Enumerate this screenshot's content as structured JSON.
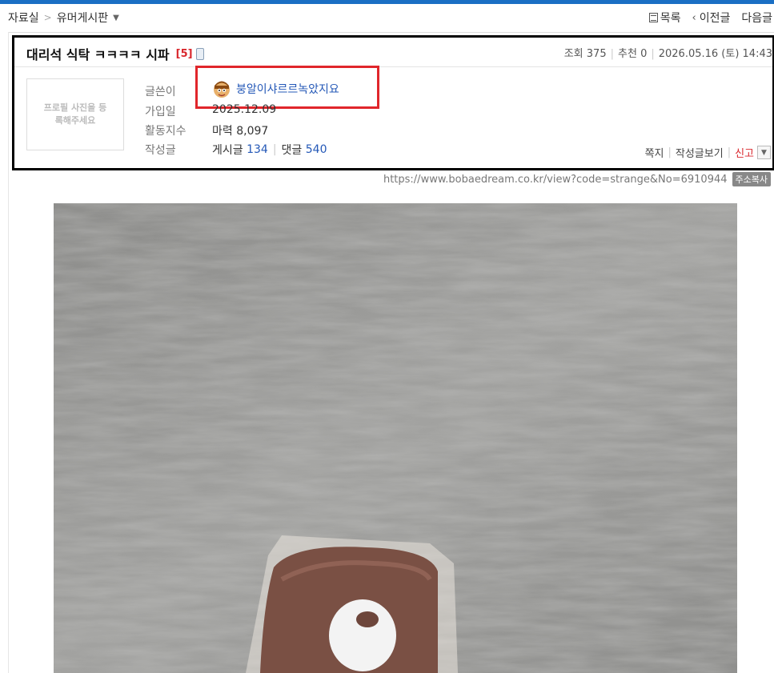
{
  "breadcrumb": {
    "section": "자료실",
    "separator": ">",
    "board": "유머게시판"
  },
  "topnav": {
    "list": "목록",
    "prev": "이전글",
    "next": "다음글"
  },
  "post": {
    "title": "대리석 식탁 ㅋㅋㅋㅋ 시파",
    "comment_count": "[5]",
    "views_label": "조회",
    "views": "375",
    "recommend_label": "추천",
    "recommend": "0",
    "date": "2026.05.16 (토) 14:43"
  },
  "profile": {
    "photo_placeholder": "프로필 사진을 등록해주세요",
    "author_label": "글쓴이",
    "author": "붕알이샤르르녹았지요",
    "joined_label": "가입일",
    "joined": "2025.12.09",
    "activity_label": "활동지수",
    "activity_value": "마력 8,097",
    "posts_label": "작성글",
    "posts_word": "게시글",
    "posts_count": "134",
    "comments_word": "댓글",
    "comments_count": "540"
  },
  "actions": {
    "message": "쪽지",
    "view_posts": "작성글보기",
    "report": "신고"
  },
  "url": {
    "text": "https://www.bobaedream.co.kr/view?code=strange&No=6910944",
    "copy": "주소복사"
  },
  "colors": {
    "accent": "#1a6fc4",
    "link": "#2458b7",
    "alert": "#d9262c"
  }
}
